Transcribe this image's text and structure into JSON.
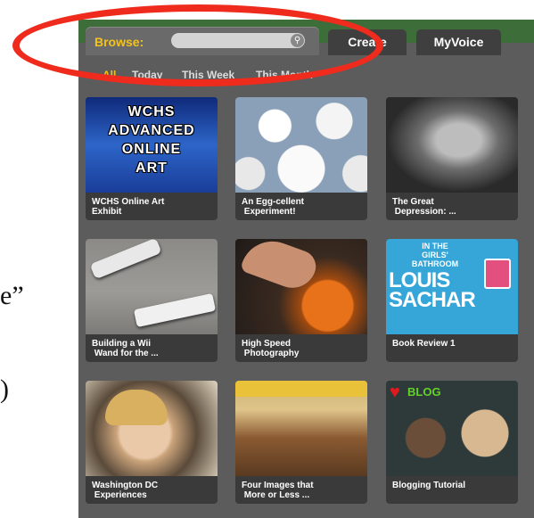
{
  "side_text": {
    "line1": "e”",
    "line2": ")"
  },
  "tabs": {
    "browse_label": "Browse:",
    "create": "Create",
    "myvoice": "MyVoice"
  },
  "search": {
    "value": "",
    "placeholder": ""
  },
  "filters": [
    {
      "label": "All",
      "active": true
    },
    {
      "label": "Today"
    },
    {
      "label": "This Week"
    },
    {
      "label": "This Month"
    }
  ],
  "tiles": [
    {
      "caption": "WCHS Online Art\nExhibit",
      "thumb_text": "WCHS\nADVANCED\nONLINE\nART"
    },
    {
      "caption": "An Egg-cellent\n Experiment!"
    },
    {
      "caption": "The Great\n Depression: ..."
    },
    {
      "caption": "Building a Wii\n Wand for the ..."
    },
    {
      "caption": "High Speed\n Photography"
    },
    {
      "caption": "Book Review 1",
      "thumb_small": "IN THE\nGIRLS'\nBATHROOM",
      "thumb_title": "LOUIS\nSACHAR"
    },
    {
      "caption": "Washington DC\n Experiences"
    },
    {
      "caption": "Four Images that\n More or Less ..."
    },
    {
      "caption": "Blogging Tutorial",
      "thumb_text": "BLOG"
    }
  ],
  "colors": {
    "accent": "#f3c21c",
    "annotation": "#ee2b1c",
    "panel": "#5c5c5c"
  }
}
